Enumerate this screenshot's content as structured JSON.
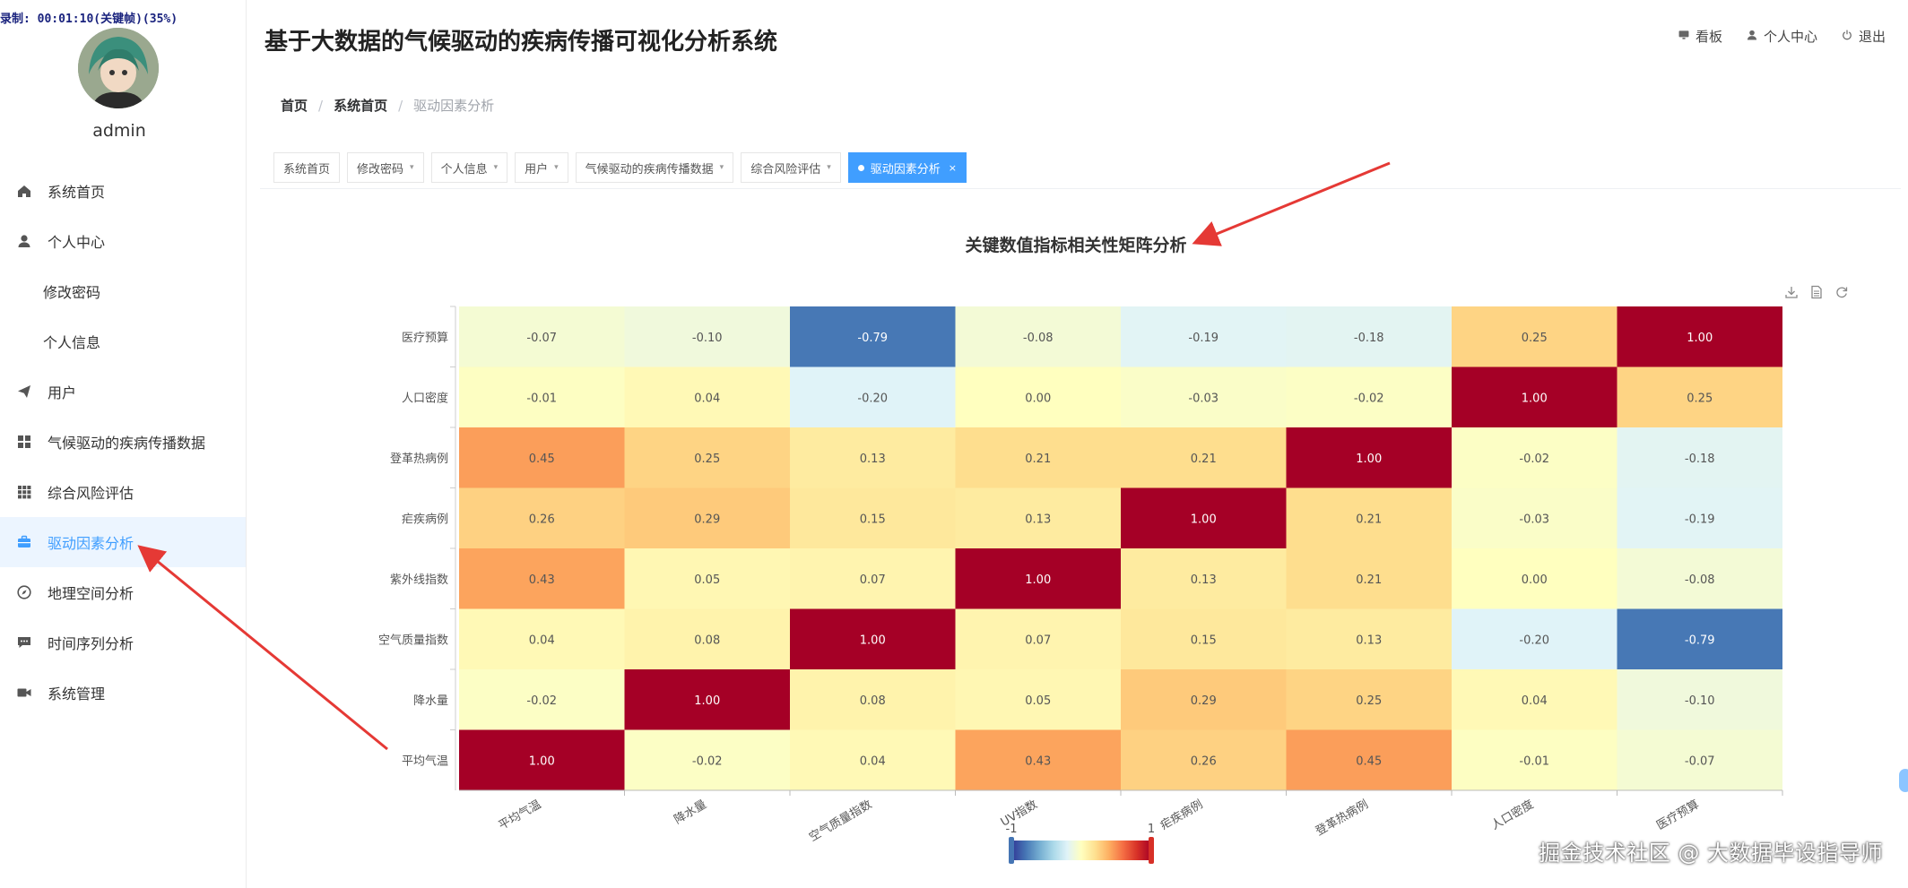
{
  "recording_overlay": "录制: 00:01:10(关键帧)(35%)",
  "user": {
    "name": "admin"
  },
  "sidebar": {
    "items": [
      {
        "label": "系统首页",
        "icon": "home-icon",
        "sub": false,
        "active": false
      },
      {
        "label": "个人中心",
        "icon": "user-icon",
        "sub": false,
        "active": false
      },
      {
        "label": "修改密码",
        "icon": "",
        "sub": true,
        "active": false
      },
      {
        "label": "个人信息",
        "icon": "",
        "sub": true,
        "active": false
      },
      {
        "label": "用户",
        "icon": "paper-plane-icon",
        "sub": false,
        "active": false
      },
      {
        "label": "气候驱动的疾病传播数据",
        "icon": "grid-icon",
        "sub": false,
        "active": false
      },
      {
        "label": "综合风险评估",
        "icon": "apps-icon",
        "sub": false,
        "active": false
      },
      {
        "label": "驱动因素分析",
        "icon": "briefcase-icon",
        "sub": false,
        "active": true
      },
      {
        "label": "地理空间分析",
        "icon": "compass-icon",
        "sub": false,
        "active": false
      },
      {
        "label": "时间序列分析",
        "icon": "chat-icon",
        "sub": false,
        "active": false
      },
      {
        "label": "系统管理",
        "icon": "camera-icon",
        "sub": false,
        "active": false
      }
    ]
  },
  "header": {
    "title": "基于大数据的气候驱动的疾病传播可视化分析系统",
    "actions": [
      {
        "label": "看板",
        "icon": "monitor-icon"
      },
      {
        "label": "个人中心",
        "icon": "user-icon"
      },
      {
        "label": "退出",
        "icon": "power-icon"
      }
    ]
  },
  "breadcrumb": [
    "首页",
    "系统首页",
    "驱动因素分析"
  ],
  "tabs": [
    {
      "label": "系统首页",
      "caret": false,
      "active": false
    },
    {
      "label": "修改密码",
      "caret": true,
      "active": false
    },
    {
      "label": "个人信息",
      "caret": true,
      "active": false
    },
    {
      "label": "用户",
      "caret": true,
      "active": false
    },
    {
      "label": "气候驱动的疾病传播数据",
      "caret": true,
      "active": false
    },
    {
      "label": "综合风险评估",
      "caret": true,
      "active": false
    },
    {
      "label": "驱动因素分析",
      "caret": false,
      "active": true
    }
  ],
  "colors": {
    "accent": "#409eff",
    "scale": [
      "#313695",
      "#4575b4",
      "#74add1",
      "#abd9e9",
      "#e0f3f8",
      "#ffffbf",
      "#fee090",
      "#fdae61",
      "#f46d43",
      "#d73027",
      "#a50026"
    ]
  },
  "toolbox": [
    "download-icon",
    "data-view-icon",
    "refresh-icon"
  ],
  "chart_data": {
    "type": "heatmap",
    "title": "关键数值指标相关性矩阵分析",
    "x_categories": [
      "平均气温",
      "降水量",
      "空气质量指数",
      "UV指数",
      "疟疾病例",
      "登革热病例",
      "人口密度",
      "医疗预算"
    ],
    "y_categories": [
      "平均气温",
      "降水量",
      "空气质量指数",
      "紫外线指数",
      "疟疾病例",
      "登革热病例",
      "人口密度",
      "医疗预算"
    ],
    "matrix": [
      [
        1.0,
        -0.02,
        0.04,
        0.43,
        0.26,
        0.45,
        -0.01,
        -0.07
      ],
      [
        -0.02,
        1.0,
        0.08,
        0.05,
        0.29,
        0.25,
        0.04,
        -0.1
      ],
      [
        0.04,
        0.08,
        1.0,
        0.07,
        0.15,
        0.13,
        -0.2,
        -0.79
      ],
      [
        0.43,
        0.05,
        0.07,
        1.0,
        0.13,
        0.21,
        0.0,
        -0.08
      ],
      [
        0.26,
        0.29,
        0.15,
        0.13,
        1.0,
        0.21,
        -0.03,
        -0.19
      ],
      [
        0.45,
        0.25,
        0.13,
        0.21,
        0.21,
        1.0,
        -0.02,
        -0.18
      ],
      [
        -0.01,
        0.04,
        -0.2,
        0.0,
        -0.03,
        -0.02,
        1.0,
        0.25
      ],
      [
        -0.07,
        -0.1,
        -0.79,
        -0.08,
        -0.19,
        -0.18,
        0.25,
        1.0
      ]
    ],
    "value_range": [
      -1,
      1
    ],
    "visual_map": {
      "min_label": "-1",
      "max_label": "1"
    }
  },
  "watermark": "掘金技术社区 @ 大数据毕设指导师"
}
